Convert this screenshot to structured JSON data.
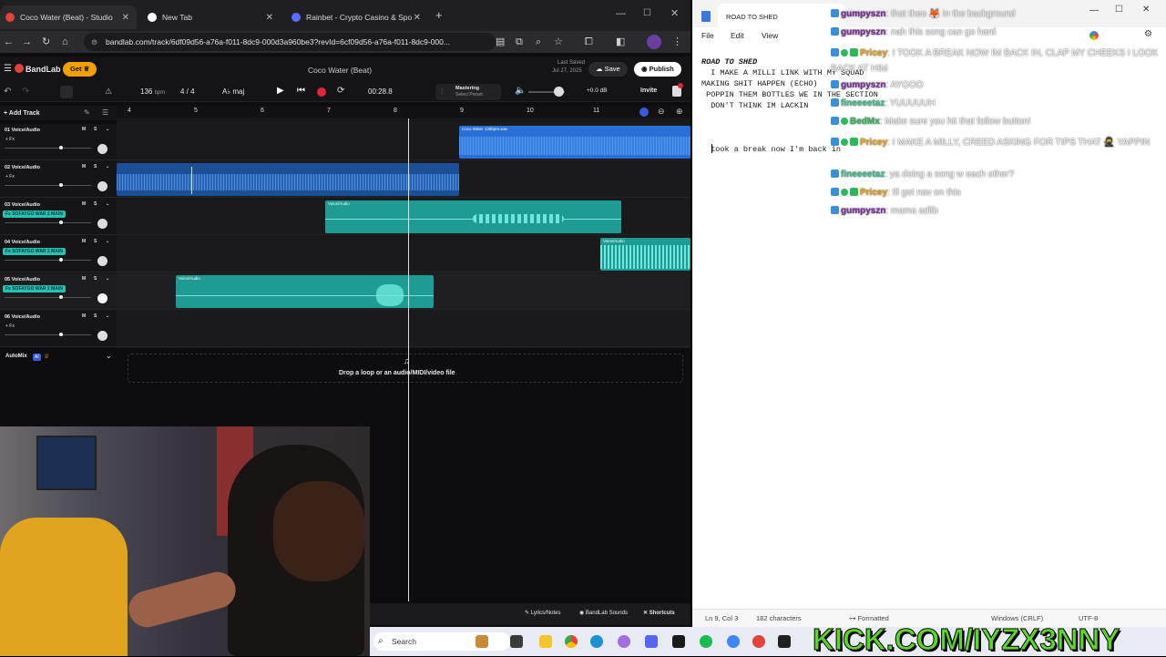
{
  "browser": {
    "tabs": [
      {
        "label": "Coco Water (Beat) - Studio",
        "active": true,
        "color": "#e0443a"
      },
      {
        "label": "New Tab",
        "active": false,
        "color": "#ffffff"
      },
      {
        "label": "Rainbet - Crypto Casino & Spo",
        "active": false,
        "color": "#5b6cff"
      }
    ],
    "url": "bandlab.com/track/6df09d56-a76a-f011-8dc9-000d3a960be3?revId=6cf09d56-a76a-f011-8dc9-000..."
  },
  "bandlab": {
    "brand": "BandLab",
    "get_label": "Get",
    "project_title": "Coco Water (Beat)",
    "last_saved_label": "Last Saved",
    "last_saved_date": "Jul 27, 2025",
    "save_label": "Save",
    "publish_label": "Publish",
    "tempo": "136",
    "tempo_unit": "bpm",
    "time_sig": "4 / 4",
    "key": "maj",
    "time": "00:28.8",
    "mastering_label": "Mastering",
    "mastering_sub": "Select Preset",
    "volume_db": "+0.0 dB",
    "invite_label": "Invite",
    "add_track_label": "Add Track",
    "ruler": [
      "4",
      "5",
      "6",
      "7",
      "8",
      "9",
      "10",
      "11"
    ],
    "tracks": [
      {
        "name": "01 Voice/Audio",
        "fx": "+ Fx",
        "fx_plugin": false
      },
      {
        "name": "02 Voice/Audio",
        "fx": "+ Fx",
        "fx_plugin": false
      },
      {
        "name": "03 Voice/Audio",
        "fx": "Fx SOFAYGO WAR 2 MAIN",
        "fx_plugin": true
      },
      {
        "name": "04 Voice/Audio",
        "fx": "Fx SOFAYGO WAR 2 MAIN",
        "fx_plugin": true
      },
      {
        "name": "05 Voice/Audio",
        "fx": "Fx SOFAYGO WAR 2 MAIN",
        "fx_plugin": true
      },
      {
        "name": "06 Voice/Audio",
        "fx": "+ Fx",
        "fx_plugin": false
      }
    ],
    "clip_labels": {
      "beat": "Coco Water 136bpm.wav",
      "voice": "Voice/Audio"
    },
    "automix_label": "AutoMix",
    "automix_badge": "AI",
    "drop_text": "Drop a loop or an audio/MIDI/video file",
    "bottom": {
      "lyrics": "Lyrics/Notes",
      "sounds": "BandLab Sounds",
      "shortcuts": "Shortcuts"
    },
    "ms": {
      "m": "M",
      "s": "S"
    }
  },
  "notepad": {
    "tab_title": "ROAD TO SHED",
    "menu": [
      "File",
      "Edit",
      "View"
    ],
    "lines": [
      "ROAD TO SHED",
      "  I MAKE A MILLI LINK WITH MY SQUAD",
      "MAKING SHIT HAPPEN (ECHO)",
      " POPPIN THEM BOTTLES WE IN THE SECTION",
      "  DON'T THINK IM LACKIN",
      "",
      "",
      "",
      "  took a break now I'm back in"
    ],
    "status": {
      "position": "Ln 9, Col 3",
      "chars": "182 characters",
      "format": "Formatted",
      "encoding": "UTF-8",
      "eol": "Windows (CRLF)"
    }
  },
  "chat": [
    {
      "user": "gumpyszn",
      "msg": "that theo 🦊 in the background",
      "color": "#7a2a9c",
      "badges": 1
    },
    {
      "user": "gumpyszn",
      "msg": "nah this song can go hard",
      "color": "#7a2a9c",
      "badges": 1
    },
    {
      "user": "Pricey",
      "msg": "I TOOK A BREAK NOW IM BACK IN, CLAP MY CHEEKS I LOOK BACK AT HIM",
      "color": "#e8a317",
      "badges": 3
    },
    {
      "user": "gumpyszn",
      "msg": "AYOOO",
      "color": "#7a2a9c",
      "badges": 1
    },
    {
      "user": "fineeeetaz",
      "msg": "YUUUUUH",
      "color": "#3bbf8c",
      "badges": 1
    },
    {
      "user": "BedMx",
      "msg": "Make sure you hit that follow button!",
      "color": "#2eb85c",
      "badges": 2
    },
    {
      "user": "Pricey",
      "msg": "I MAKE A MILLY, CREED ASKING FOR TIPS THAT 🥷 YAPPIN",
      "color": "#e8a317",
      "badges": 3
    },
    {
      "user": "fineeeetaz",
      "msg": "ya doing a song w each other?",
      "color": "#3bbf8c",
      "badges": 1
    },
    {
      "user": "Pricey",
      "msg": "Ill get nav on this",
      "color": "#e8a317",
      "badges": 3
    },
    {
      "user": "gumpyszn",
      "msg": "mama adlib",
      "color": "#7a2a9c",
      "badges": 1
    }
  ],
  "taskbar": {
    "search_label": "Search"
  },
  "watermark": "KICK.COM/IYZX3NNY"
}
